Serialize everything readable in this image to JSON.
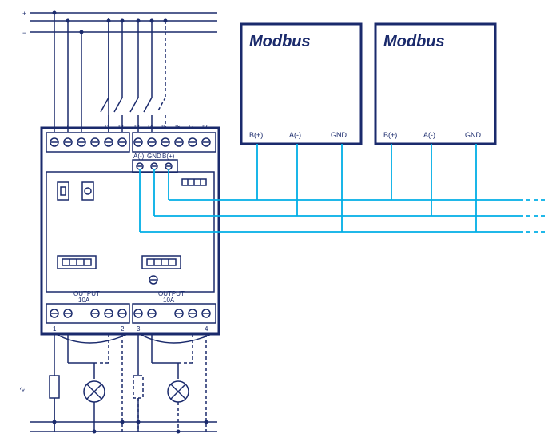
{
  "power": {
    "plus": "+",
    "minus": "−"
  },
  "device": {
    "top_terminals_left": [
      "+",
      "+",
      "-",
      "-",
      "I1",
      "I2"
    ],
    "top_terminals_right": [
      "I3",
      "I4",
      "I5",
      "I6",
      "I7",
      "I8"
    ],
    "bus_terminals": [
      "A(-)",
      "GND",
      "B(+)"
    ],
    "output_left_label": "OUTPUT",
    "output_left_rating": "10A",
    "output_right_label": "OUTPUT",
    "output_right_rating": "10A",
    "bottom_terminals_left": [
      "1",
      "2"
    ],
    "bottom_terminals_right": [
      "3",
      "4"
    ]
  },
  "modbus_nodes": [
    {
      "title": "Modbus",
      "pins": [
        "B(+)",
        "A(-)",
        "GND"
      ]
    },
    {
      "title": "Modbus",
      "pins": [
        "B(+)",
        "A(-)",
        "GND"
      ]
    }
  ],
  "ac_symbol": "∿",
  "colors": {
    "line": "#1a2a6c",
    "bus": "#00aee6"
  }
}
